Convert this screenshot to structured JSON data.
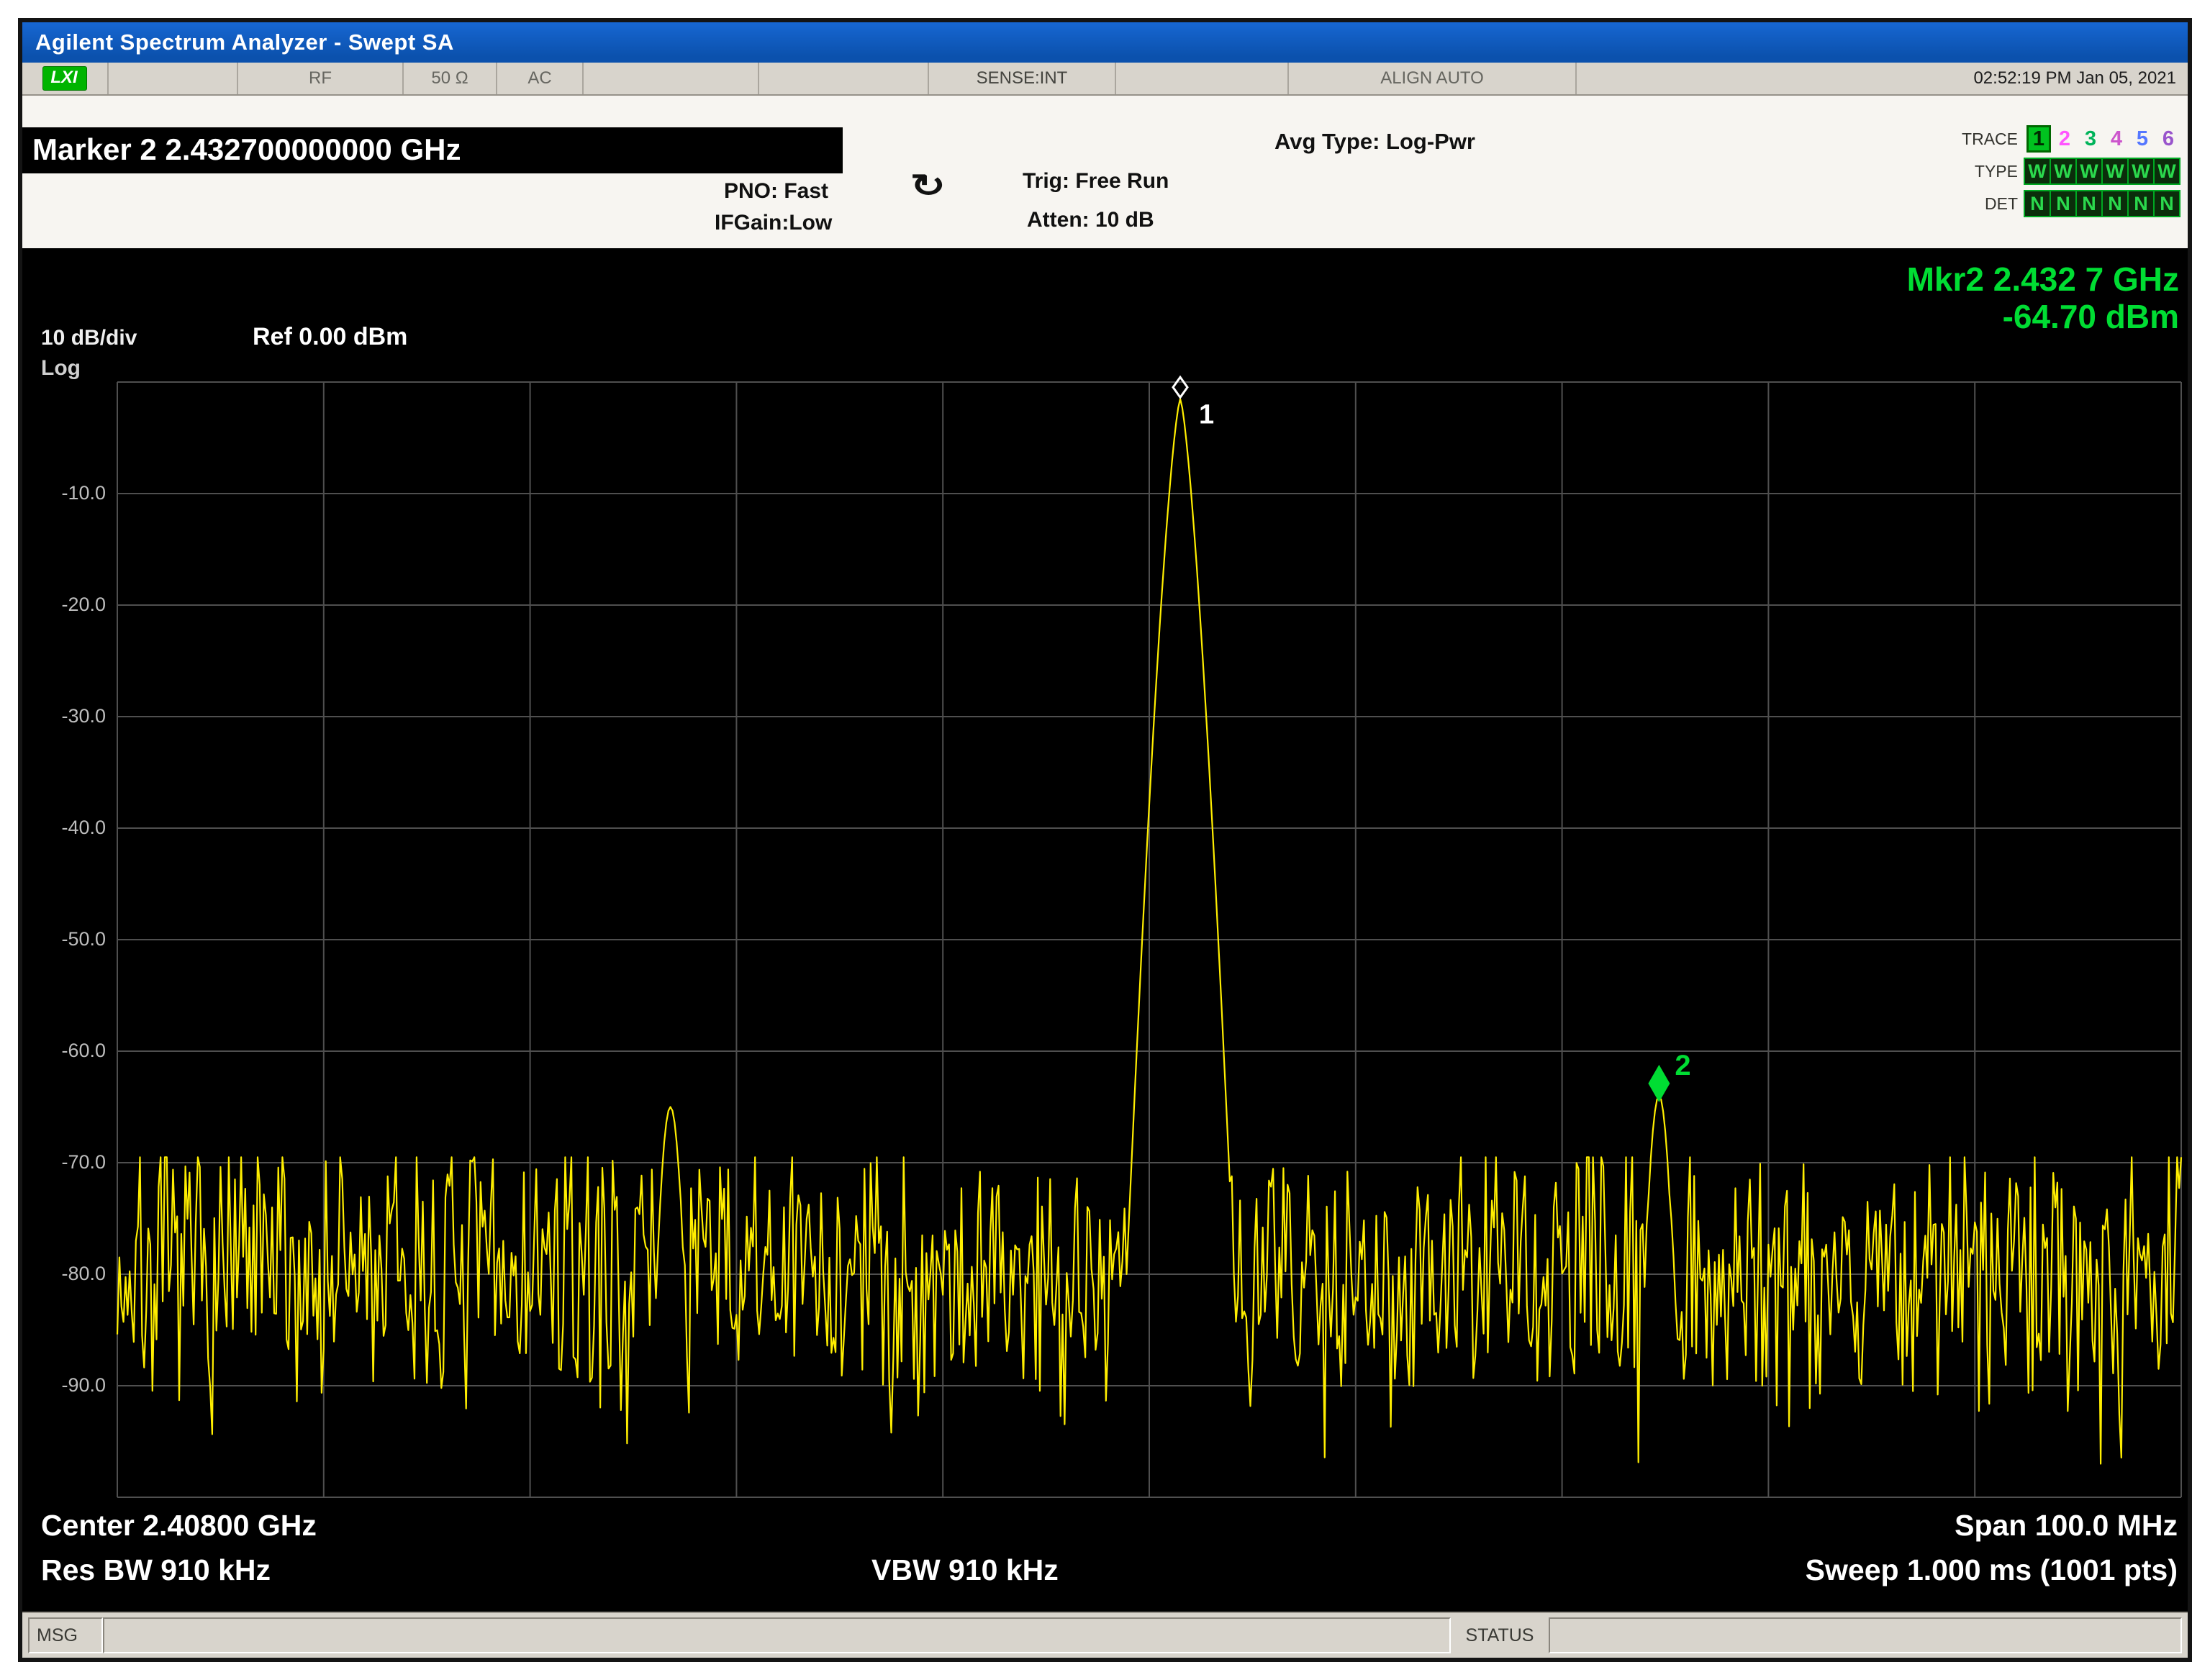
{
  "window": {
    "title": "Agilent Spectrum Analyzer - Swept SA"
  },
  "status_bar": {
    "lxi_label": "LXI",
    "rf": "RF",
    "impedance": "50 Ω",
    "coupling": "AC",
    "sense": "SENSE:INT",
    "align": "ALIGN AUTO",
    "datetime": "02:52:19 PM Jan 05, 2021"
  },
  "marker_readout": {
    "text": "Marker 2 2.432700000000 GHz"
  },
  "meas_settings": {
    "avg_type": "Avg Type: Log-Pwr",
    "pno": "PNO: Fast",
    "ifgain": "IFGain:Low",
    "trig": "Trig: Free Run",
    "atten": "Atten: 10 dB",
    "free_run_icon": "↻"
  },
  "trace_panel": {
    "trace_label": "TRACE",
    "traces": [
      "1",
      "2",
      "3",
      "4",
      "5",
      "6"
    ],
    "trace_colors": [
      "#002b00",
      "#ff55ff",
      "#00b35a",
      "#cc55cc",
      "#5577ff",
      "#9955cc"
    ],
    "selected_trace_bg": "#00c21f",
    "type_label": "TYPE",
    "types": [
      "W",
      "W",
      "W",
      "W",
      "W",
      "W"
    ],
    "det_label": "DET",
    "dets": [
      "N",
      "N",
      "N",
      "N",
      "N",
      "N"
    ]
  },
  "marker_display": {
    "line1": "Mkr2 2.432 7 GHz",
    "line2": "-64.70 dBm"
  },
  "amplitude": {
    "per_div": "10 dB/div",
    "scale": "Log",
    "ref": "Ref 0.00 dBm"
  },
  "footer": {
    "center_freq": "Center 2.40800 GHz",
    "span": "Span 100.0 MHz",
    "res_bw": "Res BW 910 kHz",
    "vbw": "VBW 910 kHz",
    "sweep": "Sweep  1.000 ms (1001 pts)"
  },
  "msg_bar": {
    "msg_label": "MSG",
    "status_label": "STATUS"
  },
  "chart_data": {
    "type": "line",
    "x_axis": {
      "center_ghz": 2.408,
      "span_mhz": 100.0,
      "start_ghz": 2.358,
      "stop_ghz": 2.458,
      "divisions": 10
    },
    "y_axis": {
      "ref_dbm": 0.0,
      "db_per_div": 10,
      "min_dbm": -100,
      "divisions": 10,
      "tick_labels": [
        "-10.0",
        "-20.0",
        "-30.0",
        "-40.0",
        "-50.0",
        "-60.0",
        "-70.0",
        "-80.0",
        "-90.0"
      ]
    },
    "sweep_points": 1001,
    "noise_floor_dbm": -80,
    "noise_spread_db": 6,
    "noise_seed": 7,
    "trace_color": "#ffee00",
    "grid_color": "#4f4f4f",
    "peaks": [
      {
        "freq_ghz": 2.4095,
        "level_dbm": -1.5,
        "skirt_k": 13000,
        "skirt_pow": 1.4
      },
      {
        "freq_ghz": 2.3848,
        "level_dbm": -65.0,
        "skirt_k": 350000,
        "skirt_pow": 2
      },
      {
        "freq_ghz": 2.4327,
        "level_dbm": -64.0,
        "skirt_k": 350000,
        "skirt_pow": 2
      }
    ],
    "markers": [
      {
        "id": "1",
        "freq_ghz": 2.4095,
        "level_dbm": -1.5,
        "color": "#ffffff",
        "style": "outline"
      },
      {
        "id": "2",
        "freq_ghz": 2.4327,
        "level_dbm": -64.7,
        "color": "#00dd33",
        "style": "filled"
      }
    ]
  }
}
